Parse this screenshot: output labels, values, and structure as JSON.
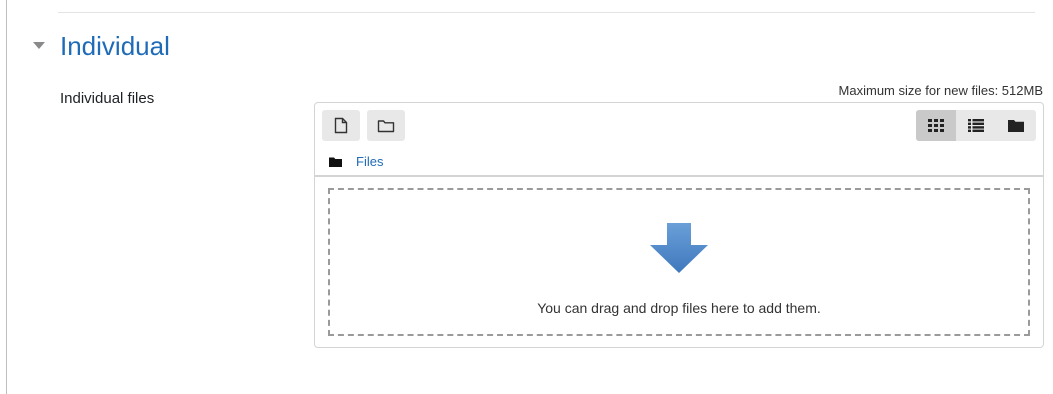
{
  "section": {
    "title": "Individual",
    "toggle_icon": "caret-down-icon"
  },
  "field": {
    "label": "Individual files"
  },
  "filepicker": {
    "max_size_text": "Maximum size for new files: 512MB",
    "toolbar": {
      "add_icon": "file-icon",
      "mkdir_icon": "folder-outline-icon",
      "views": [
        {
          "name": "icons-view",
          "icon": "grid-icon",
          "active": true
        },
        {
          "name": "list-view",
          "icon": "list-icon",
          "active": false
        },
        {
          "name": "tree-view",
          "icon": "folder-icon",
          "active": false
        }
      ]
    },
    "path": {
      "label": "Files",
      "icon": "folder-icon"
    },
    "dropzone": {
      "message": "You can drag and drop files here to add them.",
      "icon": "down-arrow-icon",
      "arrow_color": "#4a86c8"
    }
  },
  "colors": {
    "accent": "#1f6bb8",
    "border": "#d4d4d4",
    "button_bg": "#e8e8e8",
    "button_active_bg": "#c9c9c9"
  }
}
